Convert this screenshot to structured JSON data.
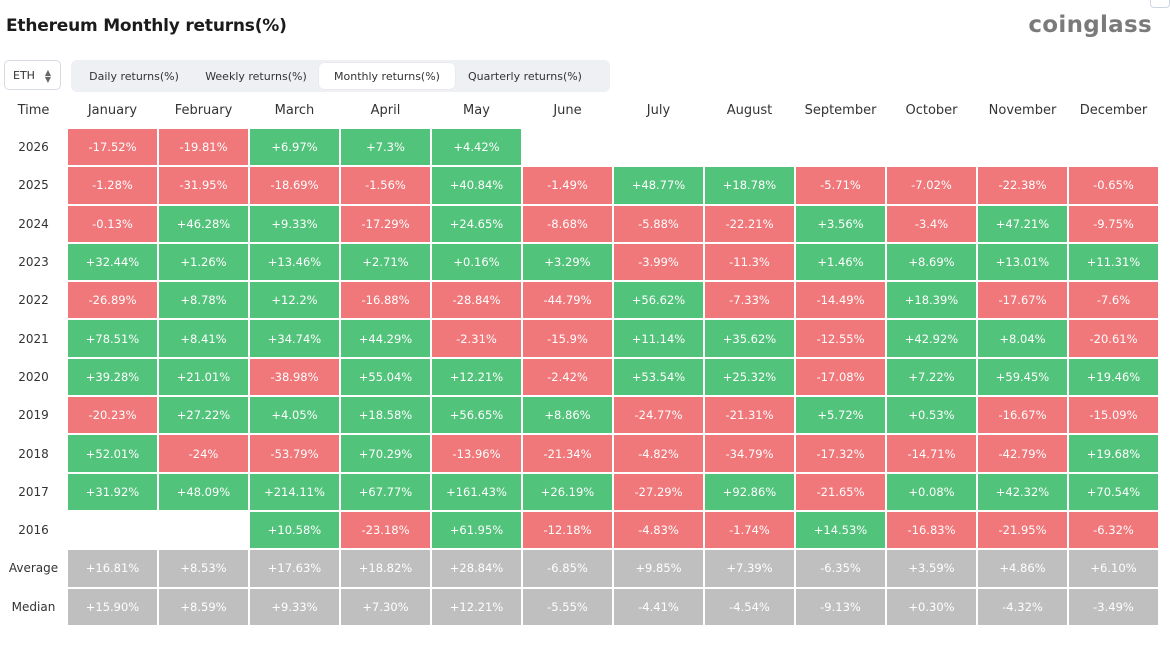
{
  "header": {
    "title": "Ethereum Monthly returns(%)",
    "brand": "coinglass"
  },
  "controls": {
    "asset": "ETH",
    "tabs": [
      {
        "label": "Daily returns(%)",
        "active": false
      },
      {
        "label": "Weekly returns(%)",
        "active": false
      },
      {
        "label": "Monthly returns(%)",
        "active": true
      },
      {
        "label": "Quarterly returns(%)",
        "active": false
      }
    ]
  },
  "colors": {
    "positive": "#52c37b",
    "negative": "#f0777a",
    "summary": "#bfbfbf"
  },
  "chart_data": {
    "type": "table",
    "title": "Ethereum Monthly returns(%)",
    "corner_label": "Time",
    "columns": [
      "January",
      "February",
      "March",
      "April",
      "May",
      "June",
      "July",
      "August",
      "September",
      "October",
      "November",
      "December"
    ],
    "rows": [
      {
        "label": "2026",
        "values": [
          "-17.52%",
          "-19.81%",
          "+6.97%",
          "+7.3%",
          "+4.42%",
          null,
          null,
          null,
          null,
          null,
          null,
          null
        ]
      },
      {
        "label": "2025",
        "values": [
          "-1.28%",
          "-31.95%",
          "-18.69%",
          "-1.56%",
          "+40.84%",
          "-1.49%",
          "+48.77%",
          "+18.78%",
          "-5.71%",
          "-7.02%",
          "-22.38%",
          "-0.65%"
        ]
      },
      {
        "label": "2024",
        "values": [
          "-0.13%",
          "+46.28%",
          "+9.33%",
          "-17.29%",
          "+24.65%",
          "-8.68%",
          "-5.88%",
          "-22.21%",
          "+3.56%",
          "-3.4%",
          "+47.21%",
          "-9.75%"
        ]
      },
      {
        "label": "2023",
        "values": [
          "+32.44%",
          "+1.26%",
          "+13.46%",
          "+2.71%",
          "+0.16%",
          "+3.29%",
          "-3.99%",
          "-11.3%",
          "+1.46%",
          "+8.69%",
          "+13.01%",
          "+11.31%"
        ]
      },
      {
        "label": "2022",
        "values": [
          "-26.89%",
          "+8.78%",
          "+12.2%",
          "-16.88%",
          "-28.84%",
          "-44.79%",
          "+56.62%",
          "-7.33%",
          "-14.49%",
          "+18.39%",
          "-17.67%",
          "-7.6%"
        ]
      },
      {
        "label": "2021",
        "values": [
          "+78.51%",
          "+8.41%",
          "+34.74%",
          "+44.29%",
          "-2.31%",
          "-15.9%",
          "+11.14%",
          "+35.62%",
          "-12.55%",
          "+42.92%",
          "+8.04%",
          "-20.61%"
        ]
      },
      {
        "label": "2020",
        "values": [
          "+39.28%",
          "+21.01%",
          "-38.98%",
          "+55.04%",
          "+12.21%",
          "-2.42%",
          "+53.54%",
          "+25.32%",
          "-17.08%",
          "+7.22%",
          "+59.45%",
          "+19.46%"
        ]
      },
      {
        "label": "2019",
        "values": [
          "-20.23%",
          "+27.22%",
          "+4.05%",
          "+18.58%",
          "+56.65%",
          "+8.86%",
          "-24.77%",
          "-21.31%",
          "+5.72%",
          "+0.53%",
          "-16.67%",
          "-15.09%"
        ]
      },
      {
        "label": "2018",
        "values": [
          "+52.01%",
          "-24%",
          "-53.79%",
          "+70.29%",
          "-13.96%",
          "-21.34%",
          "-4.82%",
          "-34.79%",
          "-17.32%",
          "-14.71%",
          "-42.79%",
          "+19.68%"
        ]
      },
      {
        "label": "2017",
        "values": [
          "+31.92%",
          "+48.09%",
          "+214.11%",
          "+67.77%",
          "+161.43%",
          "+26.19%",
          "-27.29%",
          "+92.86%",
          "-21.65%",
          "+0.08%",
          "+42.32%",
          "+70.54%"
        ]
      },
      {
        "label": "2016",
        "values": [
          null,
          null,
          "+10.58%",
          "-23.18%",
          "+61.95%",
          "-12.18%",
          "-4.83%",
          "-1.74%",
          "+14.53%",
          "-16.83%",
          "-21.95%",
          "-6.32%"
        ]
      }
    ],
    "summary_rows": [
      {
        "label": "Average",
        "values": [
          "+16.81%",
          "+8.53%",
          "+17.63%",
          "+18.82%",
          "+28.84%",
          "-6.85%",
          "+9.85%",
          "+7.39%",
          "-6.35%",
          "+3.59%",
          "+4.86%",
          "+6.10%"
        ]
      },
      {
        "label": "Median",
        "values": [
          "+15.90%",
          "+8.59%",
          "+9.33%",
          "+7.30%",
          "+12.21%",
          "-5.55%",
          "-4.41%",
          "-4.54%",
          "-9.13%",
          "+0.30%",
          "-4.32%",
          "-3.49%"
        ]
      }
    ]
  }
}
